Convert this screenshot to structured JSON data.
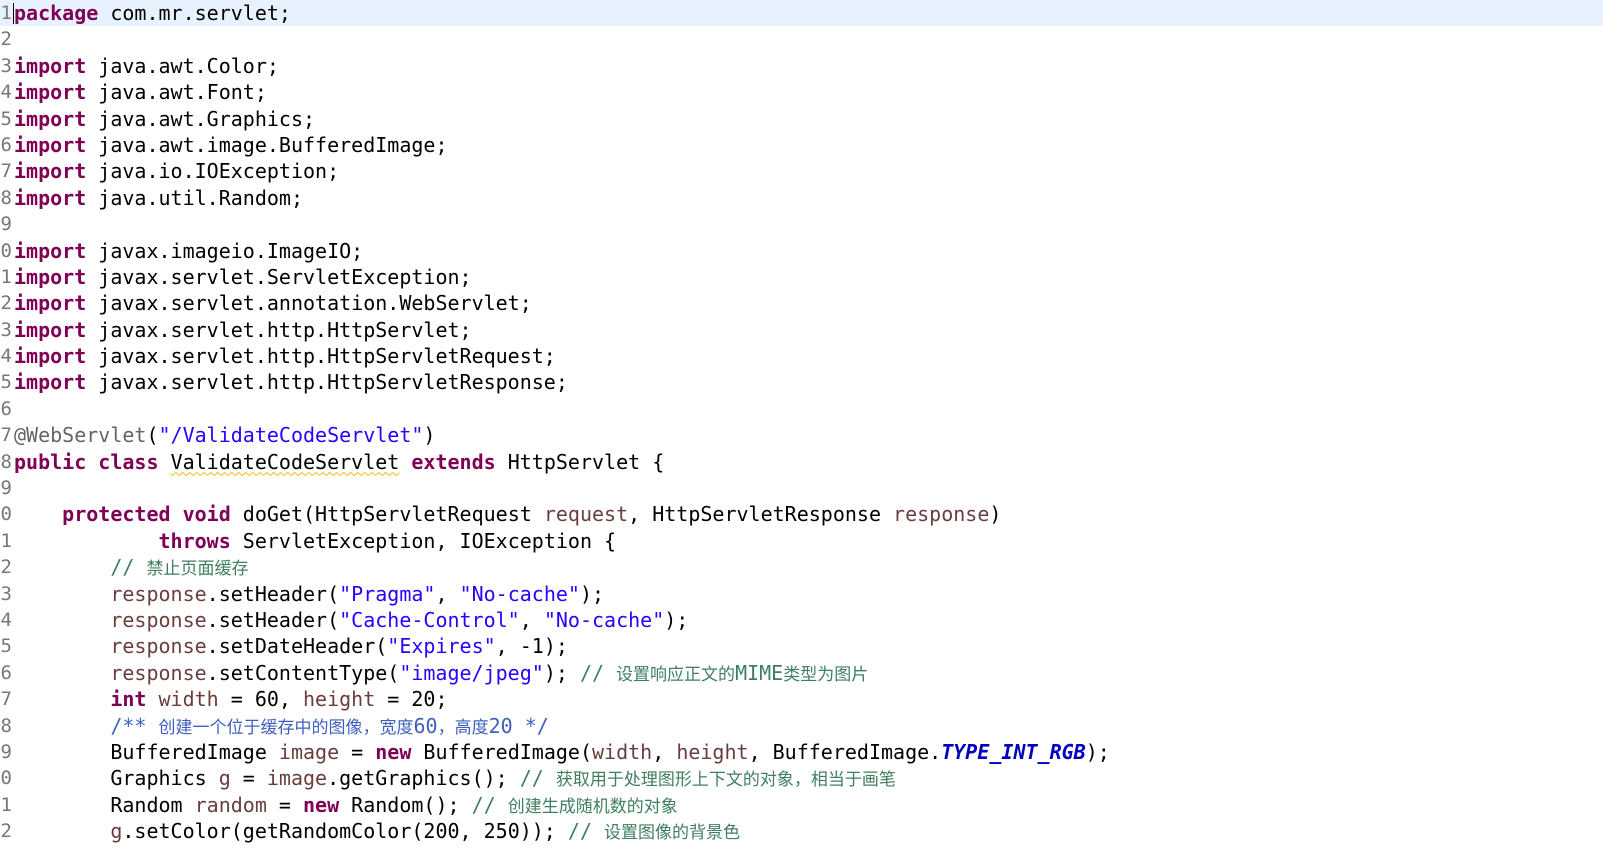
{
  "colors": {
    "keyword": "#7f0055",
    "string": "#2a00ff",
    "comment": "#3f7f5f",
    "javadoc": "#3f5fbf",
    "annotation": "#646464",
    "local_variable": "#6a3e3e",
    "static_field": "#0000c0",
    "current_line": "#e8f2fe",
    "line_number": "#787878"
  },
  "editor": {
    "current_line": 1,
    "lines": [
      {
        "num": "1",
        "tokens": [
          {
            "t": "package",
            "k": "kw"
          },
          {
            "t": " com.mr.servlet;"
          }
        ]
      },
      {
        "num": "2",
        "tokens": []
      },
      {
        "num": "3",
        "tokens": [
          {
            "t": "import",
            "k": "kw"
          },
          {
            "t": " java.awt.Color;"
          }
        ]
      },
      {
        "num": "4",
        "tokens": [
          {
            "t": "import",
            "k": "kw"
          },
          {
            "t": " java.awt.Font;"
          }
        ]
      },
      {
        "num": "5",
        "tokens": [
          {
            "t": "import",
            "k": "kw"
          },
          {
            "t": " java.awt.Graphics;"
          }
        ]
      },
      {
        "num": "6",
        "tokens": [
          {
            "t": "import",
            "k": "kw"
          },
          {
            "t": " java.awt.image.BufferedImage;"
          }
        ]
      },
      {
        "num": "7",
        "tokens": [
          {
            "t": "import",
            "k": "kw"
          },
          {
            "t": " java.io.IOException;"
          }
        ]
      },
      {
        "num": "8",
        "tokens": [
          {
            "t": "import",
            "k": "kw"
          },
          {
            "t": " java.util.Random;"
          }
        ]
      },
      {
        "num": "9",
        "tokens": []
      },
      {
        "num": "0",
        "tokens": [
          {
            "t": "import",
            "k": "kw"
          },
          {
            "t": " javax.imageio.ImageIO;"
          }
        ]
      },
      {
        "num": "1",
        "tokens": [
          {
            "t": "import",
            "k": "kw"
          },
          {
            "t": " javax.servlet.ServletException;"
          }
        ]
      },
      {
        "num": "2",
        "tokens": [
          {
            "t": "import",
            "k": "kw"
          },
          {
            "t": " javax.servlet.annotation.WebServlet;"
          }
        ]
      },
      {
        "num": "3",
        "tokens": [
          {
            "t": "import",
            "k": "kw"
          },
          {
            "t": " javax.servlet.http.HttpServlet;"
          }
        ]
      },
      {
        "num": "4",
        "tokens": [
          {
            "t": "import",
            "k": "kw"
          },
          {
            "t": " javax.servlet.http.HttpServletRequest;"
          }
        ]
      },
      {
        "num": "5",
        "tokens": [
          {
            "t": "import",
            "k": "kw"
          },
          {
            "t": " javax.servlet.http.HttpServletResponse;"
          }
        ]
      },
      {
        "num": "6",
        "tokens": []
      },
      {
        "num": "7",
        "tokens": [
          {
            "t": "@WebServlet",
            "k": "ann"
          },
          {
            "t": "("
          },
          {
            "t": "\"/ValidateCodeServlet\"",
            "k": "str"
          },
          {
            "t": ")"
          }
        ]
      },
      {
        "num": "8",
        "tokens": [
          {
            "t": "public",
            "k": "kw"
          },
          {
            "t": " "
          },
          {
            "t": "class",
            "k": "kw"
          },
          {
            "t": " "
          },
          {
            "t": "ValidateCodeServlet",
            "k": "warn"
          },
          {
            "t": " "
          },
          {
            "t": "extends",
            "k": "kw"
          },
          {
            "t": " HttpServlet {"
          }
        ]
      },
      {
        "num": "9",
        "tokens": []
      },
      {
        "num": "0",
        "tokens": [
          {
            "t": "    "
          },
          {
            "t": "protected",
            "k": "kw"
          },
          {
            "t": " "
          },
          {
            "t": "void",
            "k": "kw"
          },
          {
            "t": " doGet(HttpServletRequest "
          },
          {
            "t": "request",
            "k": "var"
          },
          {
            "t": ", HttpServletResponse "
          },
          {
            "t": "response",
            "k": "var"
          },
          {
            "t": ")"
          }
        ]
      },
      {
        "num": "1",
        "tokens": [
          {
            "t": "            "
          },
          {
            "t": "throws",
            "k": "kw"
          },
          {
            "t": " ServletException, IOException {"
          }
        ]
      },
      {
        "num": "2",
        "tokens": [
          {
            "t": "        "
          },
          {
            "t": "// ",
            "k": "cmt"
          },
          {
            "t": "禁止页面缓存",
            "k": "cmt cn"
          }
        ]
      },
      {
        "num": "3",
        "tokens": [
          {
            "t": "        "
          },
          {
            "t": "response",
            "k": "var"
          },
          {
            "t": ".setHeader("
          },
          {
            "t": "\"Pragma\"",
            "k": "str"
          },
          {
            "t": ", "
          },
          {
            "t": "\"No-cache\"",
            "k": "str"
          },
          {
            "t": ");"
          }
        ]
      },
      {
        "num": "4",
        "tokens": [
          {
            "t": "        "
          },
          {
            "t": "response",
            "k": "var"
          },
          {
            "t": ".setHeader("
          },
          {
            "t": "\"Cache-Control\"",
            "k": "str"
          },
          {
            "t": ", "
          },
          {
            "t": "\"No-cache\"",
            "k": "str"
          },
          {
            "t": ");"
          }
        ]
      },
      {
        "num": "5",
        "tokens": [
          {
            "t": "        "
          },
          {
            "t": "response",
            "k": "var"
          },
          {
            "t": ".setDateHeader("
          },
          {
            "t": "\"Expires\"",
            "k": "str"
          },
          {
            "t": ", -1);"
          }
        ]
      },
      {
        "num": "6",
        "tokens": [
          {
            "t": "        "
          },
          {
            "t": "response",
            "k": "var"
          },
          {
            "t": ".setContentType("
          },
          {
            "t": "\"image/jpeg\"",
            "k": "str"
          },
          {
            "t": "); "
          },
          {
            "t": "// ",
            "k": "cmt"
          },
          {
            "t": "设置响应正文的",
            "k": "cmt cn"
          },
          {
            "t": "MIME",
            "k": "cmt"
          },
          {
            "t": "类型为图片",
            "k": "cmt cn"
          }
        ]
      },
      {
        "num": "7",
        "tokens": [
          {
            "t": "        "
          },
          {
            "t": "int",
            "k": "kw"
          },
          {
            "t": " "
          },
          {
            "t": "width",
            "k": "var"
          },
          {
            "t": " = 60, "
          },
          {
            "t": "height",
            "k": "var"
          },
          {
            "t": " = 20;"
          }
        ]
      },
      {
        "num": "8",
        "tokens": [
          {
            "t": "        "
          },
          {
            "t": "/** ",
            "k": "jdoc"
          },
          {
            "t": "创建一个位于缓存中的图像，宽度",
            "k": "jdoc cn"
          },
          {
            "t": "60",
            "k": "jdoc"
          },
          {
            "t": "，高度",
            "k": "jdoc cn"
          },
          {
            "t": "20 */",
            "k": "jdoc"
          }
        ]
      },
      {
        "num": "9",
        "tokens": [
          {
            "t": "        BufferedImage "
          },
          {
            "t": "image",
            "k": "var"
          },
          {
            "t": " = "
          },
          {
            "t": "new",
            "k": "kw"
          },
          {
            "t": " BufferedImage("
          },
          {
            "t": "width",
            "k": "var"
          },
          {
            "t": ", "
          },
          {
            "t": "height",
            "k": "var"
          },
          {
            "t": ", BufferedImage."
          },
          {
            "t": "TYPE_INT_RGB",
            "k": "fld"
          },
          {
            "t": ");"
          }
        ]
      },
      {
        "num": "0",
        "tokens": [
          {
            "t": "        Graphics "
          },
          {
            "t": "g",
            "k": "var"
          },
          {
            "t": " = "
          },
          {
            "t": "image",
            "k": "var"
          },
          {
            "t": ".getGraphics(); "
          },
          {
            "t": "// ",
            "k": "cmt"
          },
          {
            "t": "获取用于处理图形上下文的对象，相当于画笔",
            "k": "cmt cn"
          }
        ]
      },
      {
        "num": "1",
        "tokens": [
          {
            "t": "        Random "
          },
          {
            "t": "random",
            "k": "var"
          },
          {
            "t": " = "
          },
          {
            "t": "new",
            "k": "kw"
          },
          {
            "t": " Random(); "
          },
          {
            "t": "// ",
            "k": "cmt"
          },
          {
            "t": "创建生成随机数的对象",
            "k": "cmt cn"
          }
        ]
      },
      {
        "num": "2",
        "tokens": [
          {
            "t": "        "
          },
          {
            "t": "g",
            "k": "var"
          },
          {
            "t": ".setColor(getRandomColor(200, 250)); "
          },
          {
            "t": "// ",
            "k": "cmt"
          },
          {
            "t": "设置图像的背景色",
            "k": "cmt cn"
          }
        ]
      }
    ]
  }
}
